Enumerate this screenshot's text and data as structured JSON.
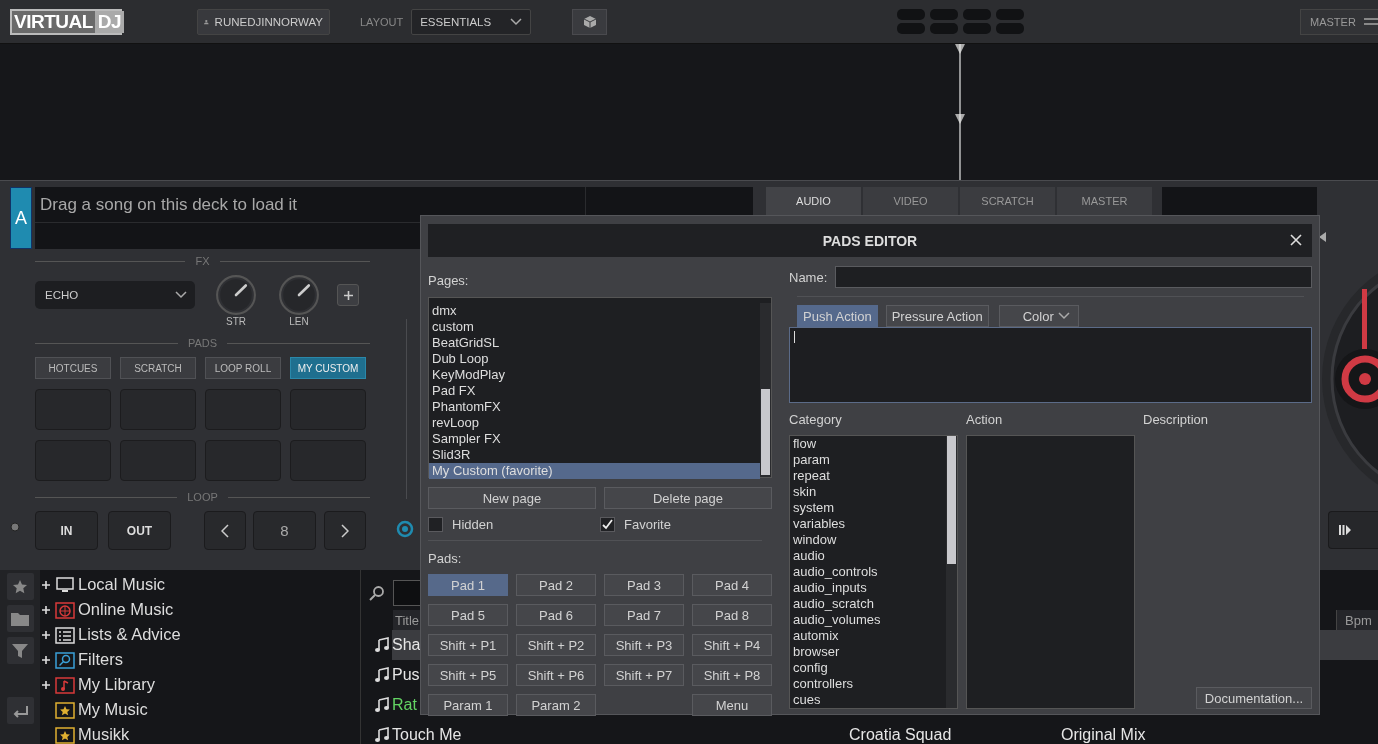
{
  "top_bar": {
    "logo": [
      "VIRTUAL",
      "DJ"
    ],
    "user": "RUNEDJINNORWAY",
    "layout_label": "LAYOUT",
    "layout": "ESSENTIALS",
    "master": "MASTER"
  },
  "deck": {
    "letter": "A",
    "song_prompt": "Drag a song on this deck to load it",
    "tabs": [
      {
        "label": "AUDIO",
        "selected": true
      },
      {
        "label": "VIDEO",
        "selected": false
      },
      {
        "label": "SCRATCH",
        "selected": false
      },
      {
        "label": "MASTER",
        "selected": false
      }
    ],
    "fx": {
      "label": "FX",
      "effect": "ECHO",
      "knobs": [
        {
          "label": "STR",
          "level": 0.67
        },
        {
          "label": "LEN",
          "level": 0.67
        }
      ]
    },
    "pads": {
      "label": "PADS",
      "modes": [
        {
          "label": "HOTCUES",
          "selected": false
        },
        {
          "label": "SCRATCH",
          "selected": false
        },
        {
          "label": "LOOP ROLL",
          "selected": false
        },
        {
          "label": "MY CUSTOM",
          "selected": true
        }
      ]
    },
    "loop": {
      "label": "LOOP",
      "buttons": [
        "IN",
        "OUT"
      ],
      "size": "8"
    }
  },
  "browser": {
    "folders": [
      {
        "label": "Local Music",
        "collapsed": true
      },
      {
        "label": "Online Music",
        "collapsed": true
      },
      {
        "label": "Lists & Advice",
        "collapsed": true
      },
      {
        "label": "Filters",
        "collapsed": true
      },
      {
        "label": "My Library",
        "collapsed": true
      },
      {
        "label": "My Music",
        "collapsed": false
      },
      {
        "label": "Musikk",
        "collapsed": false
      }
    ],
    "file_list": {
      "columns": [
        "Title",
        "Bpm"
      ],
      "rows": [
        {
          "cells": [
            "Sha"
          ],
          "selected": true,
          "color": "#e6e6e6"
        },
        {
          "cells": [
            "Pus"
          ],
          "selected": false,
          "color": "#e6e6e6"
        },
        {
          "cells": [
            "Rat"
          ],
          "selected": false,
          "color": "#63d463"
        },
        {
          "cells": [
            "Touch Me",
            "Croatia Squad",
            "Original Mix"
          ],
          "selected": false,
          "color": "#e6e6e6"
        }
      ]
    }
  },
  "pads_editor": {
    "title": "PADS EDITOR",
    "pages_label": "Pages:",
    "pages": [
      {
        "label": "dmx",
        "selected": false
      },
      {
        "label": "custom",
        "selected": false
      },
      {
        "label": "BeatGridSL",
        "selected": false
      },
      {
        "label": "Dub Loop",
        "selected": false
      },
      {
        "label": "KeyModPlay",
        "selected": false
      },
      {
        "label": "Pad FX",
        "selected": false
      },
      {
        "label": "PhantomFX",
        "selected": false
      },
      {
        "label": "revLoop",
        "selected": false
      },
      {
        "label": "Sampler FX",
        "selected": false
      },
      {
        "label": "Slid3R",
        "selected": false
      },
      {
        "label": "My Custom (favorite)",
        "selected": true
      }
    ],
    "page_buttons": [
      "New page",
      "Delete page"
    ],
    "checkboxes": [
      {
        "label": "Hidden",
        "checked": false
      },
      {
        "label": "Favorite",
        "checked": true
      }
    ],
    "pads_label": "Pads:",
    "pads": [
      {
        "label": "Pad 1",
        "selected": true
      },
      {
        "label": "Pad 2",
        "selected": false
      },
      {
        "label": "Pad 3",
        "selected": false
      },
      {
        "label": "Pad 4",
        "selected": false
      },
      {
        "label": "Pad 5",
        "selected": false
      },
      {
        "label": "Pad 6",
        "selected": false
      },
      {
        "label": "Pad 7",
        "selected": false
      },
      {
        "label": "Pad 8",
        "selected": false
      },
      {
        "label": "Shift + P1",
        "selected": false
      },
      {
        "label": "Shift + P2",
        "selected": false
      },
      {
        "label": "Shift + P3",
        "selected": false
      },
      {
        "label": "Shift + P4",
        "selected": false
      },
      {
        "label": "Shift + P5",
        "selected": false
      },
      {
        "label": "Shift + P6",
        "selected": false
      },
      {
        "label": "Shift + P7",
        "selected": false
      },
      {
        "label": "Shift + P8",
        "selected": false
      },
      {
        "label": "Param 1",
        "selected": false
      },
      {
        "label": "Param 2",
        "selected": false
      }
    ],
    "menu_button": "Menu",
    "name_label": "Name:",
    "action_tabs": [
      {
        "label": "Push Action",
        "selected": true
      },
      {
        "label": "Pressure Action",
        "selected": false
      }
    ],
    "color_dropdown": "Color",
    "category_label": "Category",
    "categories": [
      "flow",
      "param",
      "repeat",
      "skin",
      "system",
      "variables",
      "window",
      "audio",
      "audio_controls",
      "audio_inputs",
      "audio_scratch",
      "audio_volumes",
      "automix",
      "browser",
      "config",
      "controllers",
      "cues"
    ],
    "action_label": "Action",
    "description_label": "Description",
    "documentation_button": "Documentation..."
  }
}
